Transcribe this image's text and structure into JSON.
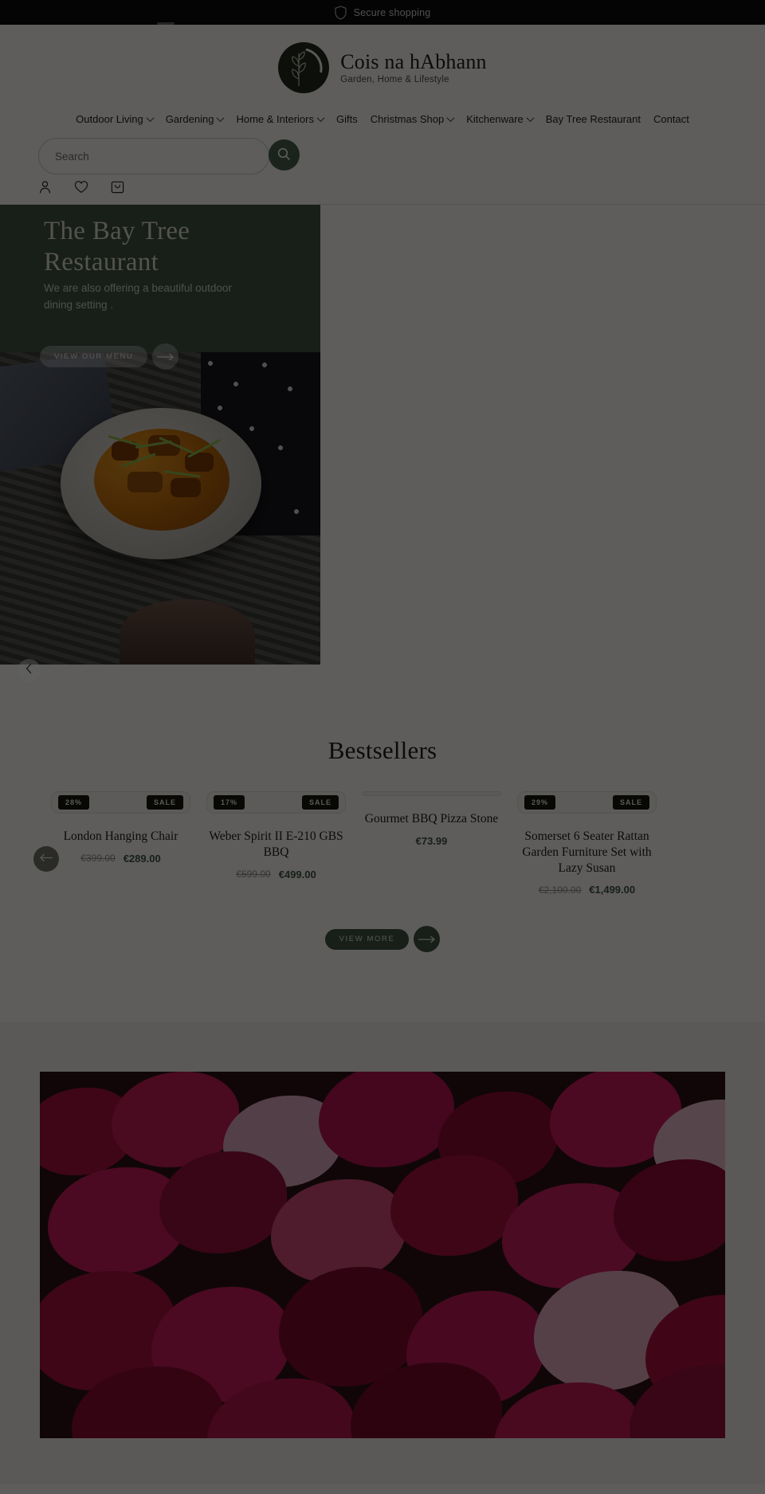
{
  "topbar": {
    "message": "Secure shopping",
    "icon": "shield-icon"
  },
  "brand": {
    "name": "Cois na hAbhann",
    "tagline": "Garden, Home & Lifestyle"
  },
  "nav": {
    "items": [
      {
        "label": "Outdoor Living",
        "has_dropdown": true
      },
      {
        "label": "Gardening",
        "has_dropdown": true
      },
      {
        "label": "Home & Interiors",
        "has_dropdown": true
      },
      {
        "label": "Gifts",
        "has_dropdown": false
      },
      {
        "label": "Christmas Shop",
        "has_dropdown": true
      },
      {
        "label": "Kitchenware",
        "has_dropdown": true
      },
      {
        "label": "Bay Tree Restaurant",
        "has_dropdown": false
      },
      {
        "label": "Contact",
        "has_dropdown": false
      }
    ]
  },
  "search": {
    "placeholder": "Search",
    "value": "",
    "button_icon": "search-icon"
  },
  "account_icons": [
    {
      "name": "account-icon"
    },
    {
      "name": "wishlist-heart-icon"
    },
    {
      "name": "cart-bag-icon"
    }
  ],
  "hero": {
    "title": "The Bay Tree Restaurant",
    "subtitle": "We are also offering a beautiful outdoor dining setting .",
    "cta_label": "VIEW OUR MENU",
    "cta_arrow_icon": "arrow-right-icon",
    "prev_icon": "chevron-left-icon",
    "background_color": "#3d5340"
  },
  "bestsellers": {
    "title": "Bestsellers",
    "prev_icon": "arrow-left-icon",
    "view_more_label": "VIEW MORE",
    "view_more_arrow_icon": "arrow-right-icon",
    "sale_label": "SALE",
    "products": [
      {
        "title": "London Hanging Chair",
        "discount": "28%",
        "sale": "SALE",
        "price_old": "€399.00",
        "price_new": "€289.00"
      },
      {
        "title": "Weber Spirit II E-210 GBS BBQ",
        "discount": "17%",
        "sale": "SALE",
        "price_old": "€599.00",
        "price_new": "€499.00"
      },
      {
        "title": "Gourmet BBQ Pizza Stone",
        "discount": "",
        "sale": "",
        "price_old": "",
        "price_new": "€73.99"
      },
      {
        "title": "Somerset 6 Seater Rattan Garden Furniture Set with Lazy Susan",
        "discount": "29%",
        "sale": "SALE",
        "price_old": "€2,100.00",
        "price_new": "€1,499.00"
      }
    ]
  },
  "colors": {
    "accent_green": "#3d5340",
    "page_background": "#f6f5f1",
    "badge_dark": "#16160f",
    "price_sale": "#3d5340"
  }
}
